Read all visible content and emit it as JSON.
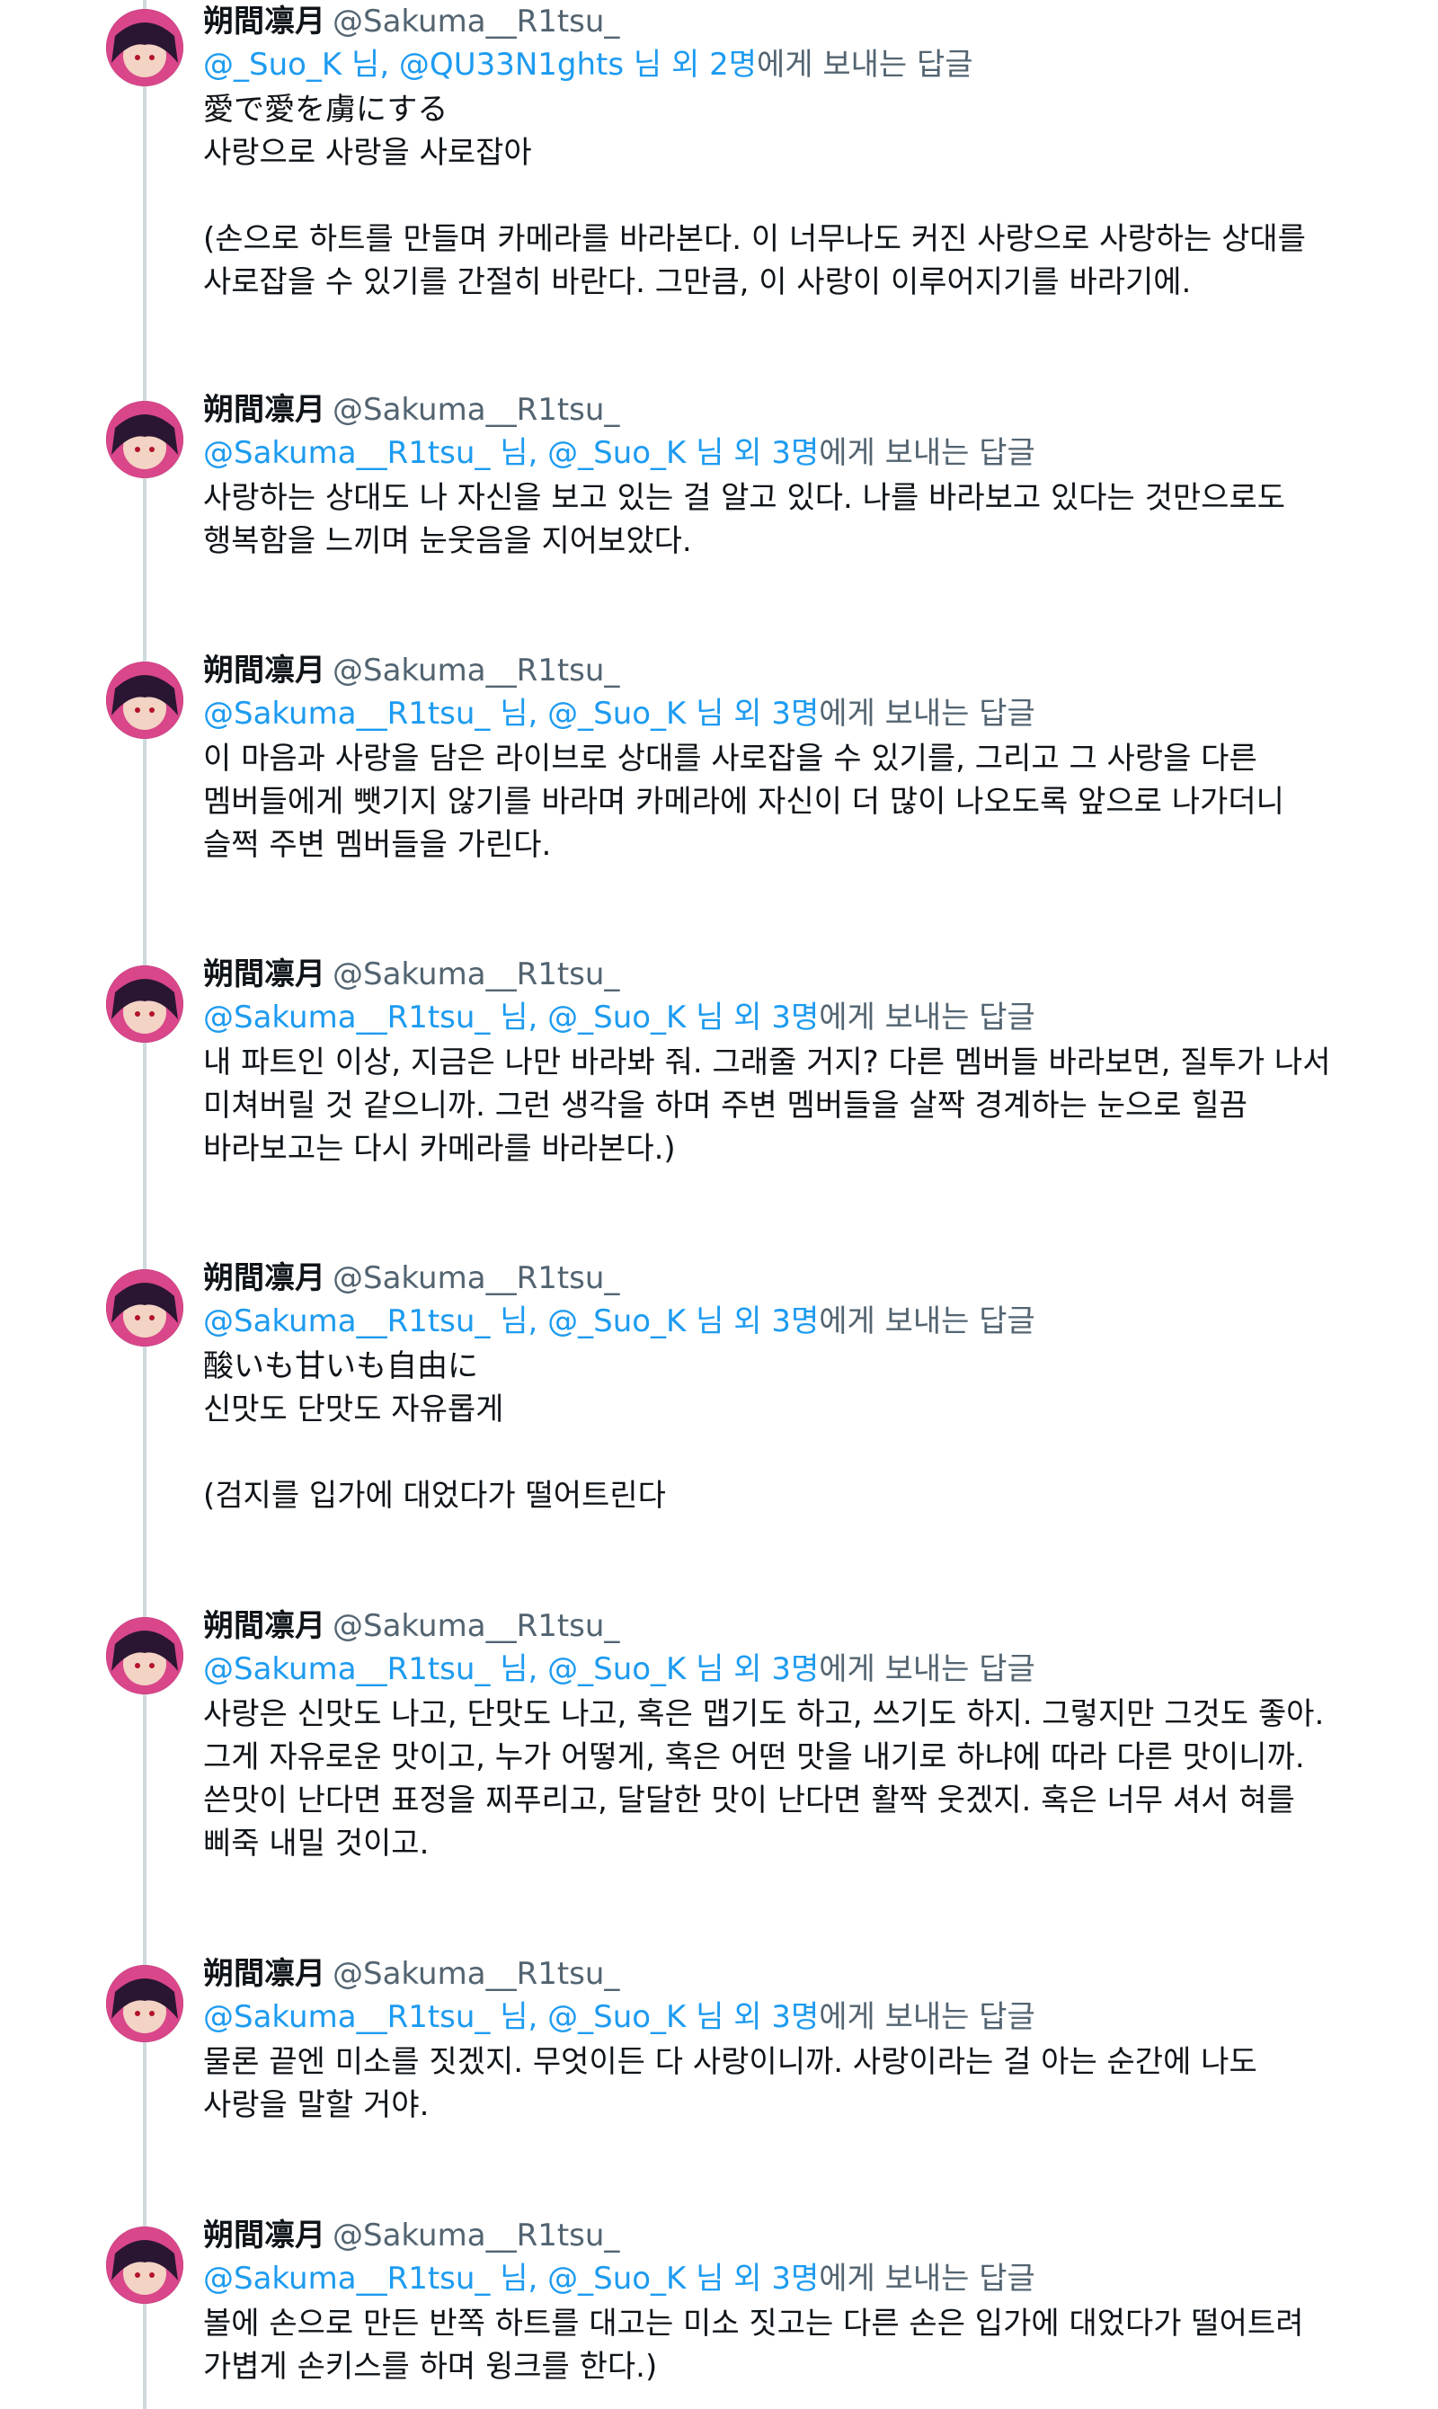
{
  "author": {
    "name": "朔間凛月",
    "handle": "@Sakuma__R1tsu_",
    "avatar_icon": "avatar-image"
  },
  "tweets": [
    {
      "reply_mentions": "@_Suo_K 님, @QU33N1ghts 님 외 2명",
      "reply_suffix": "에게 보내는 답글",
      "text": "愛で愛を虜にする\n사랑으로 사랑을 사로잡아\n\n(손으로 하트를 만들며 카메라를 바라본다. 이 너무나도 커진 사랑으로 사랑하는 상대를\n사로잡을 수 있기를 간절히 바란다. 그만큼, 이 사랑이 이루어지기를 바라기에."
    },
    {
      "reply_mentions": "@Sakuma__R1tsu_ 님, @_Suo_K 님 외 3명",
      "reply_suffix": "에게 보내는 답글",
      "text": "사랑하는 상대도 나 자신을 보고 있는 걸 알고 있다. 나를 바라보고 있다는 것만으로도\n행복함을 느끼며 눈웃음을 지어보았다."
    },
    {
      "reply_mentions": "@Sakuma__R1tsu_ 님, @_Suo_K 님 외 3명",
      "reply_suffix": "에게 보내는 답글",
      "text": "이 마음과 사랑을 담은 라이브로 상대를 사로잡을 수 있기를, 그리고 그 사랑을 다른\n멤버들에게 뺏기지 않기를 바라며 카메라에 자신이 더 많이 나오도록 앞으로 나가더니\n슬쩍 주변 멤버들을 가린다."
    },
    {
      "reply_mentions": "@Sakuma__R1tsu_ 님, @_Suo_K 님 외 3명",
      "reply_suffix": "에게 보내는 답글",
      "text": "내 파트인 이상, 지금은 나만 바라봐 줘. 그래줄 거지? 다른 멤버들 바라보면, 질투가 나서\n미쳐버릴 것 같으니까. 그런 생각을 하며 주변 멤버들을 살짝 경계하는 눈으로 힐끔\n바라보고는 다시 카메라를 바라본다.)"
    },
    {
      "reply_mentions": "@Sakuma__R1tsu_ 님, @_Suo_K 님 외 3명",
      "reply_suffix": "에게 보내는 답글",
      "text": "酸いも甘いも自由に\n신맛도 단맛도 자유롭게\n\n(검지를 입가에 대었다가 떨어트린다"
    },
    {
      "reply_mentions": "@Sakuma__R1tsu_ 님, @_Suo_K 님 외 3명",
      "reply_suffix": "에게 보내는 답글",
      "text": "사랑은 신맛도 나고, 단맛도 나고, 혹은 맵기도 하고, 쓰기도 하지. 그렇지만 그것도 좋아.\n그게 자유로운 맛이고, 누가 어떻게, 혹은 어떤 맛을 내기로 하냐에 따라 다른 맛이니까.\n쓴맛이 난다면 표정을 찌푸리고, 달달한 맛이 난다면 활짝 웃겠지. 혹은 너무 셔서 혀를\n삐죽 내밀 것이고."
    },
    {
      "reply_mentions": "@Sakuma__R1tsu_ 님, @_Suo_K 님 외 3명",
      "reply_suffix": "에게 보내는 답글",
      "text": "물론 끝엔 미소를 짓겠지. 무엇이든 다 사랑이니까. 사랑이라는 걸 아는 순간에 나도\n사랑을 말할 거야."
    },
    {
      "reply_mentions": "@Sakuma__R1tsu_ 님, @_Suo_K 님 외 3명",
      "reply_suffix": "에게 보내는 답글",
      "text": "볼에 손으로 만든 반쪽 하트를 대고는 미소 짓고는 다른 손은 입가에 대었다가 떨어트려\n가볍게 손키스를 하며 윙크를 한다.)"
    }
  ]
}
